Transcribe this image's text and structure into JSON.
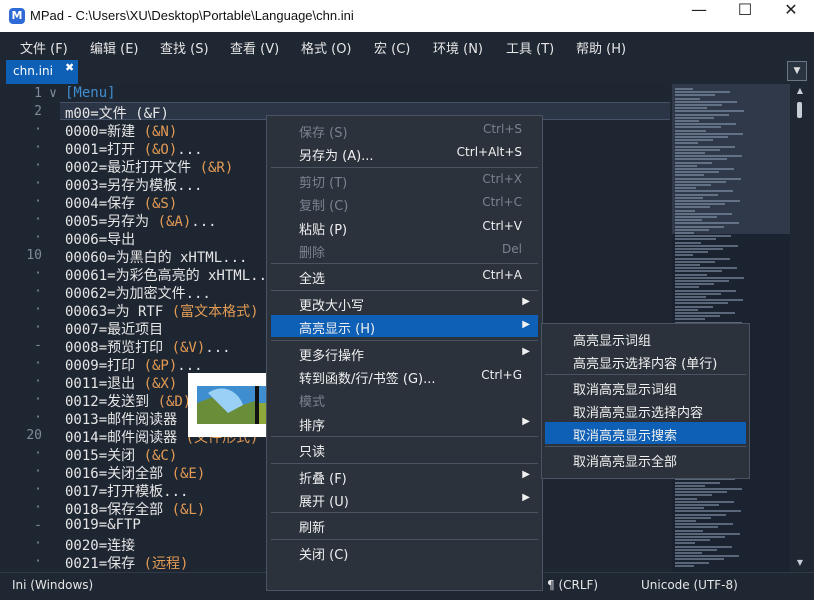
{
  "window": {
    "title": "MPad - C:\\Users\\XU\\Desktop\\Portable\\Language\\chn.ini",
    "app_icon_letter": "M",
    "controls": {
      "minimize": "—",
      "maximize": "☐",
      "close": "✕"
    }
  },
  "menubar": [
    "文件 (F)",
    "编辑 (E)",
    "查找 (S)",
    "查看 (V)",
    "格式 (O)",
    "宏 (C)",
    "环境 (N)",
    "工具 (T)",
    "帮助 (H)"
  ],
  "tabs": [
    {
      "label": "chn.ini",
      "close": "✖"
    }
  ],
  "tab_dropdown": "▼",
  "editor": {
    "line_numbers": [
      {
        "n": "1",
        "fold": "∨"
      },
      {
        "n": "2"
      },
      {
        "n": "·"
      },
      {
        "n": "·"
      },
      {
        "n": "·"
      },
      {
        "n": "·"
      },
      {
        "n": "·"
      },
      {
        "n": "·"
      },
      {
        "n": "·"
      },
      {
        "n": "10"
      },
      {
        "n": "·"
      },
      {
        "n": "·"
      },
      {
        "n": "·"
      },
      {
        "n": "·"
      },
      {
        "n": "-"
      },
      {
        "n": "·"
      },
      {
        "n": "·"
      },
      {
        "n": "·"
      },
      {
        "n": "·"
      },
      {
        "n": "20"
      },
      {
        "n": "·"
      },
      {
        "n": "·"
      },
      {
        "n": "·"
      },
      {
        "n": "·"
      },
      {
        "n": "-"
      },
      {
        "n": "·"
      },
      {
        "n": "·"
      }
    ],
    "lines": [
      [
        [
          "[Menu]",
          "#3f8fd0"
        ]
      ],
      [
        [
          "m00=文件 ",
          "#e6e6e6"
        ],
        [
          "(&F)",
          "#e6e6e6"
        ]
      ],
      [
        [
          "0000=新建 ",
          "#e6e6e6"
        ],
        [
          "(&N)",
          "#e39b54"
        ]
      ],
      [
        [
          "0001=打开 ",
          "#e6e6e6"
        ],
        [
          "(&O)",
          "#e39b54"
        ],
        [
          "...",
          "#e6e6e6"
        ]
      ],
      [
        [
          "0002=最近打开文件 ",
          "#e6e6e6"
        ],
        [
          "(&R)",
          "#e39b54"
        ]
      ],
      [
        [
          "0003=另存为模板...",
          "#e6e6e6"
        ]
      ],
      [
        [
          "0004=保存 ",
          "#e6e6e6"
        ],
        [
          "(&S)",
          "#e39b54"
        ]
      ],
      [
        [
          "0005=另存为 ",
          "#e6e6e6"
        ],
        [
          "(&A)",
          "#e39b54"
        ],
        [
          "...",
          "#e6e6e6"
        ]
      ],
      [
        [
          "0006=导出",
          "#e6e6e6"
        ]
      ],
      [
        [
          "00060=为黑白的 xHTML...",
          "#e6e6e6"
        ]
      ],
      [
        [
          "00061=为彩色高亮的 xHTML...",
          "#e6e6e6"
        ]
      ],
      [
        [
          "00062=为加密文件...",
          "#e6e6e6"
        ]
      ],
      [
        [
          "00063=为 RTF ",
          "#e6e6e6"
        ],
        [
          "(富文本格式)",
          "#e39b54"
        ]
      ],
      [
        [
          "0007=最近项目",
          "#e6e6e6"
        ]
      ],
      [
        [
          "0008=预览打印 ",
          "#e6e6e6"
        ],
        [
          "(&V)",
          "#e39b54"
        ],
        [
          "...",
          "#e6e6e6"
        ]
      ],
      [
        [
          "0009=打印 ",
          "#e6e6e6"
        ],
        [
          "(&P)",
          "#e39b54"
        ],
        [
          "...",
          "#e6e6e6"
        ]
      ],
      [
        [
          "0011=退出 ",
          "#e6e6e6"
        ],
        [
          "(&X)",
          "#e39b54"
        ]
      ],
      [
        [
          "0012=发送到 ",
          "#e6e6e6"
        ],
        [
          "(&D)",
          "#e39b54"
        ]
      ],
      [
        [
          "0013=邮件阅读器",
          "#e6e6e6"
        ]
      ],
      [
        [
          "0014=邮件阅读器 ",
          "#e6e6e6"
        ],
        [
          "(文件形式)",
          "#e39b54"
        ]
      ],
      [
        [
          "0015=关闭 ",
          "#e6e6e6"
        ],
        [
          "(&C)",
          "#e39b54"
        ]
      ],
      [
        [
          "0016=关闭全部 ",
          "#e6e6e6"
        ],
        [
          "(&E)",
          "#e39b54"
        ]
      ],
      [
        [
          "0017=打开模板...",
          "#e6e6e6"
        ]
      ],
      [
        [
          "0018=保存全部 ",
          "#e6e6e6"
        ],
        [
          "(&L)",
          "#e39b54"
        ]
      ],
      [
        [
          "0019=&FTP",
          "#e6e6e6"
        ]
      ],
      [
        [
          "0020=连接",
          "#e6e6e6"
        ]
      ],
      [
        [
          "0021=保存 ",
          "#e6e6e6"
        ],
        [
          "(远程)",
          "#e39b54"
        ]
      ]
    ]
  },
  "context_menu": {
    "items": [
      {
        "label": "保存 (S)",
        "shortcut": "Ctrl+S",
        "disabled": true
      },
      {
        "label": "另存为 (A)...",
        "shortcut": "Ctrl+Alt+S"
      },
      {
        "sep": true
      },
      {
        "label": "剪切 (T)",
        "shortcut": "Ctrl+X",
        "disabled": true
      },
      {
        "label": "复制 (C)",
        "shortcut": "Ctrl+C",
        "disabled": true
      },
      {
        "label": "粘贴 (P)",
        "shortcut": "Ctrl+V"
      },
      {
        "label": "删除",
        "shortcut": "Del",
        "disabled": true
      },
      {
        "sep": true
      },
      {
        "label": "全选",
        "shortcut": "Ctrl+A"
      },
      {
        "sep": true
      },
      {
        "label": "更改大小写",
        "submenu": true
      },
      {
        "label": "高亮显示 (H)",
        "submenu": true,
        "highlighted": true
      },
      {
        "sep": true
      },
      {
        "label": "更多行操作",
        "submenu": true
      },
      {
        "label": "转到函数/行/书签 (G)...",
        "shortcut": "Ctrl+G"
      },
      {
        "label": "模式",
        "disabled": true
      },
      {
        "label": "排序",
        "submenu": true
      },
      {
        "sep": true
      },
      {
        "label": "只读"
      },
      {
        "sep": true
      },
      {
        "label": "折叠 (F)",
        "submenu": true
      },
      {
        "label": "展开 (U)",
        "submenu": true
      },
      {
        "sep": true
      },
      {
        "label": "刷新"
      },
      {
        "sep": true
      },
      {
        "label": "关闭 (C)"
      }
    ],
    "submenu_arrow": "▶"
  },
  "submenu": {
    "items": [
      {
        "label": "高亮显示词组"
      },
      {
        "label": "高亮显示选择内容 (单行)"
      },
      {
        "sep": true
      },
      {
        "label": "取消高亮显示词组"
      },
      {
        "label": "取消高亮显示选择内容"
      },
      {
        "label": "取消高亮显示搜索",
        "highlighted": true
      },
      {
        "sep": true
      },
      {
        "label": "取消高亮显示全部"
      }
    ]
  },
  "statusbar": {
    "mode": "Ini (Windows)",
    "line_ending": "¶ (CRLF)",
    "encoding": "Unicode (UTF-8)"
  },
  "scrollbar": {
    "up": "▲",
    "down": "▼"
  },
  "colors": {
    "accent": "#0e60b6",
    "bracket": "#3f8fd0",
    "value": "#e39b54"
  }
}
